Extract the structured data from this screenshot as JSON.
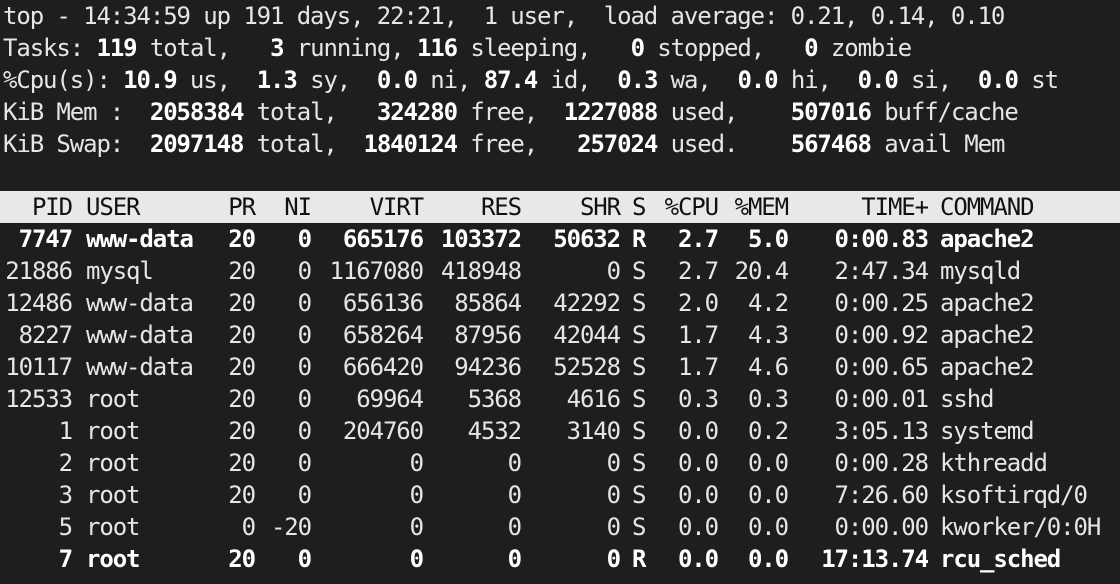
{
  "summary": {
    "l1": {
      "label": "top - ",
      "time": "14:34:59",
      "up_label": " up ",
      "uptime": "191 days, 22:21",
      "users": ",  1 user,",
      "load_label": "  load average: ",
      "load": "0.21, 0.14, 0.10"
    },
    "l2": {
      "label": "Tasks:",
      "total": "119",
      "total_label": "total,",
      "running": "3",
      "running_label": "running,",
      "sleeping": "116",
      "sleeping_label": "sleeping,",
      "stopped": "0",
      "stopped_label": "stopped,",
      "zombie": "0",
      "zombie_label": "zombie"
    },
    "l3": {
      "label": "%Cpu(s):",
      "us": "10.9",
      "us_l": "us,",
      "sy": "1.3",
      "sy_l": "sy,",
      "ni": "0.0",
      "ni_l": "ni,",
      "id": "87.4",
      "id_l": "id,",
      "wa": "0.3",
      "wa_l": "wa,",
      "hi": "0.0",
      "hi_l": "hi,",
      "si": "0.0",
      "si_l": "si,",
      "st": "0.0",
      "st_l": "st"
    },
    "l4": {
      "label": "KiB Mem :",
      "total": "2058384",
      "total_l": "total,",
      "free": "324280",
      "free_l": "free,",
      "used": "1227088",
      "used_l": "used,",
      "buff": "507016",
      "buff_l": "buff/cache"
    },
    "l5": {
      "label": "KiB Swap:",
      "total": "2097148",
      "total_l": "total,",
      "free": "1840124",
      "free_l": "free,",
      "used": "257024",
      "used_l": "used.",
      "avail": "567468",
      "avail_l": "avail Mem"
    }
  },
  "columns": [
    "PID",
    "USER",
    "PR",
    "NI",
    "VIRT",
    "RES",
    "SHR",
    "S",
    "%CPU",
    "%MEM",
    "TIME+",
    "COMMAND"
  ],
  "processes": [
    {
      "pid": "7747",
      "user": "www-data",
      "pr": "20",
      "ni": "0",
      "virt": "665176",
      "res": "103372",
      "shr": "50632",
      "s": "R",
      "cpu": "2.7",
      "mem": "5.0",
      "time": "0:00.83",
      "cmd": "apache2",
      "bold": true
    },
    {
      "pid": "21886",
      "user": "mysql",
      "pr": "20",
      "ni": "0",
      "virt": "1167080",
      "res": "418948",
      "shr": "0",
      "s": "S",
      "cpu": "2.7",
      "mem": "20.4",
      "time": "2:47.34",
      "cmd": "mysqld",
      "bold": false
    },
    {
      "pid": "12486",
      "user": "www-data",
      "pr": "20",
      "ni": "0",
      "virt": "656136",
      "res": "85864",
      "shr": "42292",
      "s": "S",
      "cpu": "2.0",
      "mem": "4.2",
      "time": "0:00.25",
      "cmd": "apache2",
      "bold": false
    },
    {
      "pid": "8227",
      "user": "www-data",
      "pr": "20",
      "ni": "0",
      "virt": "658264",
      "res": "87956",
      "shr": "42044",
      "s": "S",
      "cpu": "1.7",
      "mem": "4.3",
      "time": "0:00.92",
      "cmd": "apache2",
      "bold": false
    },
    {
      "pid": "10117",
      "user": "www-data",
      "pr": "20",
      "ni": "0",
      "virt": "666420",
      "res": "94236",
      "shr": "52528",
      "s": "S",
      "cpu": "1.7",
      "mem": "4.6",
      "time": "0:00.65",
      "cmd": "apache2",
      "bold": false
    },
    {
      "pid": "12533",
      "user": "root",
      "pr": "20",
      "ni": "0",
      "virt": "69964",
      "res": "5368",
      "shr": "4616",
      "s": "S",
      "cpu": "0.3",
      "mem": "0.3",
      "time": "0:00.01",
      "cmd": "sshd",
      "bold": false
    },
    {
      "pid": "1",
      "user": "root",
      "pr": "20",
      "ni": "0",
      "virt": "204760",
      "res": "4532",
      "shr": "3140",
      "s": "S",
      "cpu": "0.0",
      "mem": "0.2",
      "time": "3:05.13",
      "cmd": "systemd",
      "bold": false
    },
    {
      "pid": "2",
      "user": "root",
      "pr": "20",
      "ni": "0",
      "virt": "0",
      "res": "0",
      "shr": "0",
      "s": "S",
      "cpu": "0.0",
      "mem": "0.0",
      "time": "0:00.28",
      "cmd": "kthreadd",
      "bold": false
    },
    {
      "pid": "3",
      "user": "root",
      "pr": "20",
      "ni": "0",
      "virt": "0",
      "res": "0",
      "shr": "0",
      "s": "S",
      "cpu": "0.0",
      "mem": "0.0",
      "time": "7:26.60",
      "cmd": "ksoftirqd/0",
      "bold": false
    },
    {
      "pid": "5",
      "user": "root",
      "pr": "0",
      "ni": "-20",
      "virt": "0",
      "res": "0",
      "shr": "0",
      "s": "S",
      "cpu": "0.0",
      "mem": "0.0",
      "time": "0:00.00",
      "cmd": "kworker/0:0H",
      "bold": false
    },
    {
      "pid": "7",
      "user": "root",
      "pr": "20",
      "ni": "0",
      "virt": "0",
      "res": "0",
      "shr": "0",
      "s": "R",
      "cpu": "0.0",
      "mem": "0.0",
      "time": "17:13.74",
      "cmd": "rcu_sched",
      "bold": true
    }
  ]
}
